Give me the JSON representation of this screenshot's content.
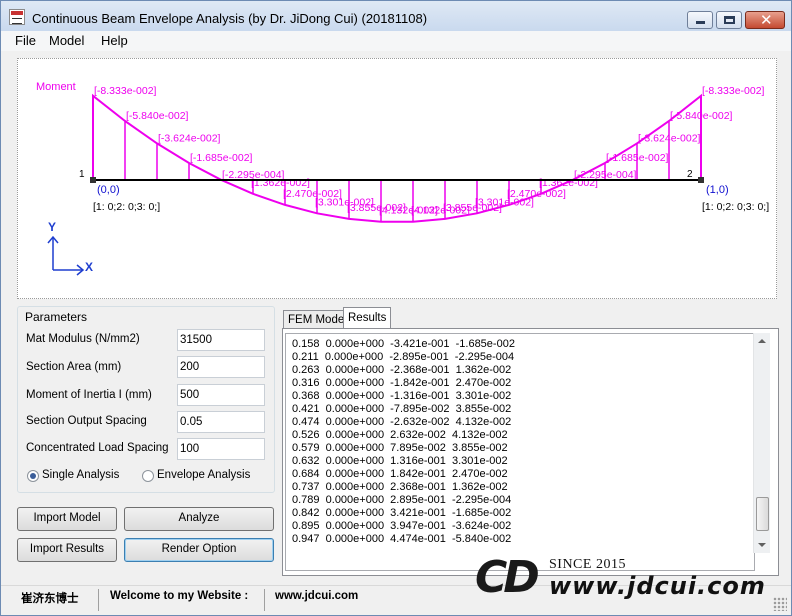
{
  "window": {
    "title": "Continuous Beam Envelope Analysis (by Dr. JiDong Cui) (20181108)"
  },
  "menu": [
    "File",
    "Model",
    "Help"
  ],
  "diagram": {
    "moment_label": "Moment",
    "node1_id": "1",
    "node2_id": "2",
    "node1_coord": "(0,0)",
    "node2_coord": "(1,0)",
    "node1_restraint": "[1: 0;2: 0;3: 0;]",
    "node2_restraint": "[1: 0;2: 0;3: 0;]",
    "axis_y": "Y",
    "axis_x": "X",
    "moment_color": "#ee00ee",
    "value_labels": [
      "[-8.333e-002]",
      "[-5.840e-002]",
      "[-3.624e-002]",
      "[-1.685e-002]",
      "[-2.295e-004]",
      "[1.362e-002]",
      "[2.470e-002]",
      "[3.301e-002]",
      "[3.855e-002]",
      "[4.132e-002]",
      "[4.132e-002]",
      "[3.855e-002]",
      "[3.301e-002]",
      "[2.470e-002]",
      "[1.362e-002]",
      "[-2.295e-004]",
      "[-1.685e-002]",
      "[-3.624e-002]",
      "[-5.840e-002]",
      "[-8.333e-002]"
    ]
  },
  "parameters": {
    "title": "Parameters",
    "fields": [
      {
        "label": "Mat Modulus (N/mm2)",
        "value": "31500"
      },
      {
        "label": "Section Area  (mm)",
        "value": "200"
      },
      {
        "label": "Moment of Inertia I (mm)",
        "value": "500"
      },
      {
        "label": "Section Output Spacing",
        "value": "0.05"
      },
      {
        "label": "Concentrated Load Spacing",
        "value": "100"
      }
    ],
    "single_analysis": "Single Analysis",
    "envelope_analysis": "Envelope Analysis",
    "selected_mode": "single"
  },
  "buttons": {
    "import_model": "Import Model",
    "analyze": "Analyze",
    "import_results": "Import Results",
    "render_option": "Render Option"
  },
  "tabs": [
    "FEM Model",
    "Results"
  ],
  "active_tab": "Results",
  "results_lines": [
    "0.158  0.000e+000  -3.421e-001  -1.685e-002",
    "0.211  0.000e+000  -2.895e-001  -2.295e-004",
    "0.263  0.000e+000  -2.368e-001  1.362e-002",
    "0.316  0.000e+000  -1.842e-001  2.470e-002",
    "0.368  0.000e+000  -1.316e-001  3.301e-002",
    "0.421  0.000e+000  -7.895e-002  3.855e-002",
    "0.474  0.000e+000  -2.632e-002  4.132e-002",
    "0.526  0.000e+000  2.632e-002  4.132e-002",
    "0.579  0.000e+000  7.895e-002  3.855e-002",
    "0.632  0.000e+000  1.316e-001  3.301e-002",
    "0.684  0.000e+000  1.842e-001  2.470e-002",
    "0.737  0.000e+000  2.368e-001  1.362e-002",
    "0.789  0.000e+000  2.895e-001  -2.295e-004",
    "0.842  0.000e+000  3.421e-001  -1.685e-002",
    "0.895  0.000e+000  3.947e-001  -3.624e-002",
    "0.947  0.000e+000  4.474e-001  -5.840e-002"
  ],
  "status": {
    "author": "崔济东博士",
    "welcome": "Welcome to my Website :",
    "website": "www.jdcui.com"
  },
  "logo": {
    "mark": "CD",
    "since": "SINCE 2015",
    "url": "www.jdcui.com"
  }
}
